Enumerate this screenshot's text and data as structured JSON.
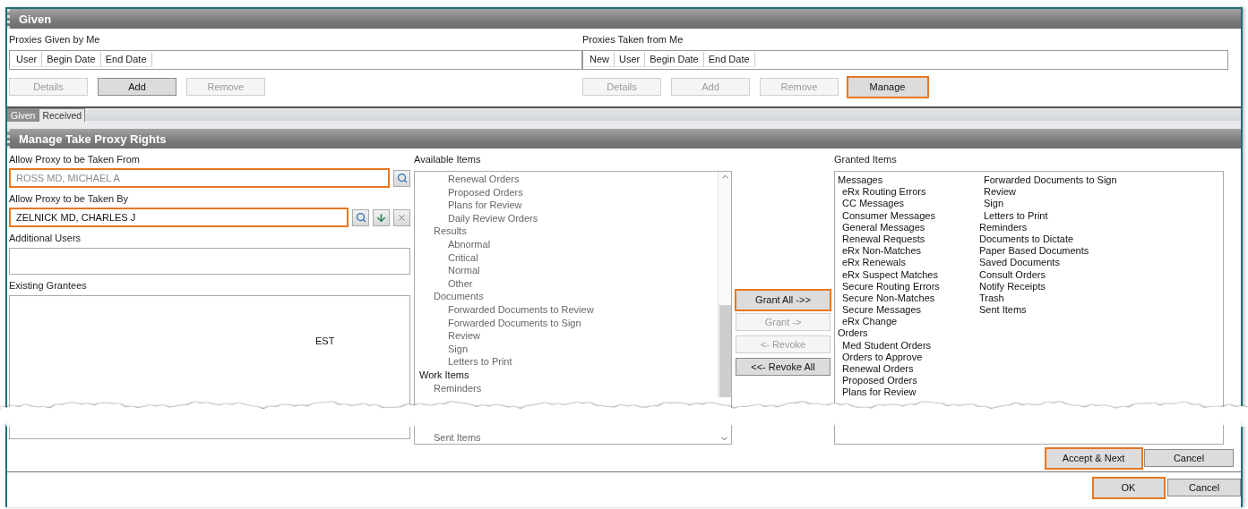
{
  "given": {
    "title": "Given",
    "panels": [
      {
        "label": "Proxies Given by Me",
        "columns": [
          "User",
          "Begin Date",
          "End Date"
        ],
        "buttons": [
          {
            "label": "Details",
            "disabled": true,
            "highlighted": false
          },
          {
            "label": "Add",
            "disabled": false,
            "highlighted": false
          },
          {
            "label": "Remove",
            "disabled": true,
            "highlighted": false
          }
        ]
      },
      {
        "label": "Proxies Taken from Me",
        "columns": [
          "New",
          "User",
          "Begin Date",
          "End Date"
        ],
        "buttons": [
          {
            "label": "Details",
            "disabled": true,
            "highlighted": false
          },
          {
            "label": "Add",
            "disabled": true,
            "highlighted": false
          },
          {
            "label": "Remove",
            "disabled": true,
            "highlighted": false
          },
          {
            "label": "Manage",
            "disabled": false,
            "highlighted": true
          }
        ]
      }
    ]
  },
  "tabs": [
    {
      "label": "Given",
      "selected": true
    },
    {
      "label": "Received",
      "selected": false
    }
  ],
  "manage": {
    "title": "Manage Take Proxy Rights",
    "take_from": {
      "label": "Allow Proxy to be Taken From",
      "value": "ROSS MD, MICHAEL A",
      "disabled": true,
      "highlighted": true
    },
    "take_by": {
      "label": "Allow Proxy to be Taken By",
      "value": "ZELNICK MD, CHARLES J",
      "disabled": false,
      "highlighted": true
    },
    "additional_users": {
      "label": "Additional Users"
    },
    "existing_grantees": {
      "label": "Existing Grantees",
      "rows": [
        "EST"
      ]
    },
    "available_items": {
      "label": "Available Items",
      "tree": [
        {
          "children": [
            {
              "children": [
                {
                  "label": "Renewal Orders"
                },
                {
                  "label": "Proposed Orders"
                },
                {
                  "label": "Plans for Review"
                },
                {
                  "label": "Daily Review Orders"
                }
              ]
            },
            {
              "label": "Results",
              "children": [
                {
                  "label": "Abnormal"
                },
                {
                  "label": "Critical"
                },
                {
                  "label": "Normal"
                },
                {
                  "label": "Other"
                }
              ]
            },
            {
              "label": "Documents",
              "children": [
                {
                  "label": "Forwarded Documents to Review"
                },
                {
                  "label": "Forwarded Documents to Sign"
                },
                {
                  "label": "Review"
                },
                {
                  "label": "Sign"
                },
                {
                  "label": "Letters to Print"
                }
              ]
            }
          ]
        },
        {
          "label": "Work Items",
          "children": [
            {
              "label": "Reminders"
            },
            {
              "label": "Sent Items"
            }
          ]
        }
      ]
    },
    "transfer_buttons": [
      {
        "label": "Grant All ->>",
        "disabled": false,
        "highlighted": true
      },
      {
        "label": "Grant ->",
        "disabled": true,
        "highlighted": false
      },
      {
        "label": "<- Revoke",
        "disabled": true,
        "highlighted": false
      },
      {
        "label": "<<- Revoke All",
        "disabled": false,
        "highlighted": false
      }
    ],
    "granted_items": {
      "label": "Granted Items",
      "tree": [
        {
          "label": "Messages",
          "children": [
            {
              "label": "eRx Routing Errors"
            },
            {
              "label": "CC Messages"
            },
            {
              "label": "Consumer Messages"
            },
            {
              "label": "General Messages"
            },
            {
              "label": "Renewal Requests"
            },
            {
              "label": "eRx Non-Matches"
            },
            {
              "label": "eRx Renewals"
            },
            {
              "label": "eRx Suspect Matches"
            },
            {
              "label": "Secure Routing Errors"
            },
            {
              "label": "Secure Non-Matches"
            },
            {
              "label": "Secure Messages"
            },
            {
              "label": "eRx Change"
            }
          ]
        },
        {
          "label": "Orders",
          "children": [
            {
              "label": "Med Student Orders"
            },
            {
              "label": "Orders to Approve"
            },
            {
              "label": "Renewal Orders"
            },
            {
              "label": "Proposed Orders"
            },
            {
              "label": "Plans for Review"
            }
          ]
        },
        {
          "children": [
            {
              "label": "Forwarded Documents to Sign"
            },
            {
              "label": "Review"
            },
            {
              "label": "Sign"
            },
            {
              "label": "Letters to Print"
            }
          ]
        },
        {
          "label": "Reminders"
        },
        {
          "label": "Documents to Dictate"
        },
        {
          "label": "Paper Based Documents"
        },
        {
          "label": "Saved Documents"
        },
        {
          "label": "Consult Orders"
        },
        {
          "label": "Notify Receipts"
        },
        {
          "label": "Trash"
        },
        {
          "label": "Sent Items"
        }
      ]
    },
    "buttons": [
      {
        "label": "Accept & Next",
        "disabled": false,
        "highlighted": true
      },
      {
        "label": "Cancel",
        "disabled": false,
        "highlighted": false
      }
    ]
  },
  "footer_buttons": [
    {
      "label": "OK",
      "disabled": false,
      "highlighted": true
    },
    {
      "label": "Cancel",
      "disabled": false,
      "highlighted": false
    }
  ]
}
